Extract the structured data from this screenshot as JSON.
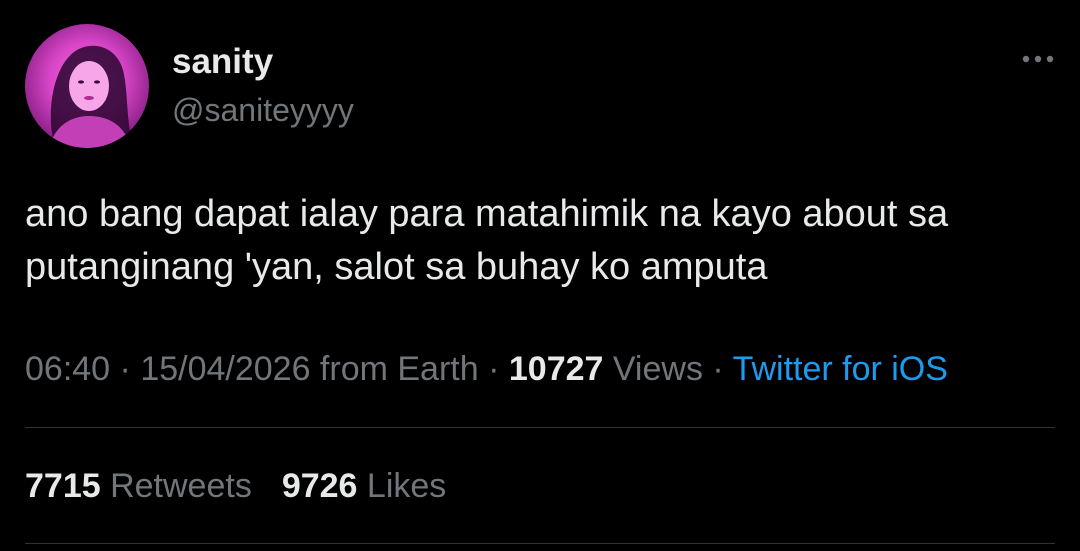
{
  "author": {
    "display_name": "sanity",
    "handle": "@saniteyyyy",
    "avatar_icon": "profile-photo"
  },
  "tweet": {
    "text": "ano bang dapat ialay para matahimik na kayo about sa\nputanginang 'yan, salot sa buhay ko amputa"
  },
  "meta": {
    "time": "06:40",
    "sep1": " · ",
    "date": "15/04/2026",
    "location": " from Earth",
    "sep2": " · ",
    "views_count": "10727",
    "views_label": " Views",
    "sep3": " · ",
    "source": "Twitter for iOS"
  },
  "stats": {
    "retweets_count": "7715",
    "retweets_label": " Retweets",
    "likes_count": "9726",
    "likes_label": " Likes"
  },
  "colors": {
    "background": "#000000",
    "text_primary": "#e7e9ea",
    "text_secondary": "#71767b",
    "link": "#1d9bf0",
    "divider": "#2f3336",
    "avatar_tint": "#d946c8"
  },
  "icons": {
    "more": "more-horizontal-icon"
  }
}
